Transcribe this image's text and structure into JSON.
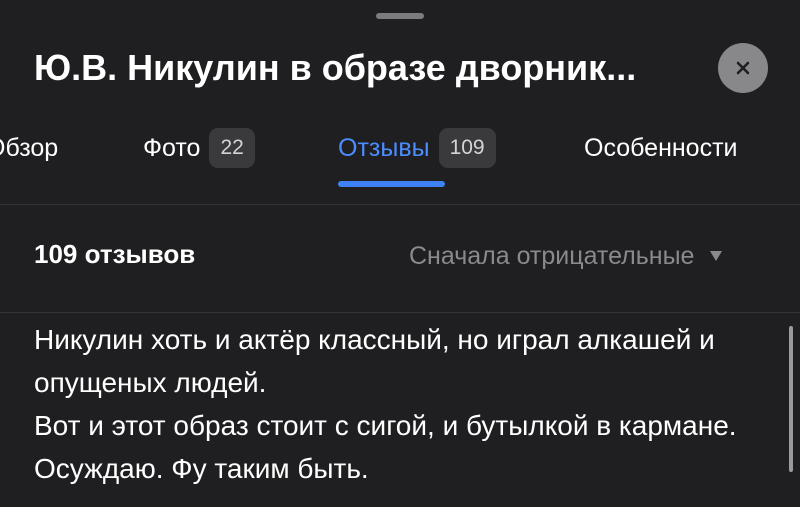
{
  "header": {
    "title": "Ю.В. Никулин в образе дворник...",
    "close_icon": "close-icon"
  },
  "tabs": [
    {
      "label": "Обзор",
      "count": null,
      "active": false
    },
    {
      "label": "Фото",
      "count": "22",
      "active": false
    },
    {
      "label": "Отзывы",
      "count": "109",
      "active": true
    },
    {
      "label": "Особенности",
      "count": null,
      "active": false
    }
  ],
  "reviews": {
    "count_label": "109 отзывов",
    "sort_label": "Сначала отрицательные",
    "sort_icon": "chevron-down-icon",
    "items": [
      {
        "text_lines": [
          "Никулин хоть и актёр классный, но играл алкашей и опущеных людей.",
          "Вот и этот образ стоит с сигой, и бутылкой в кармане. Осуждаю. Фу таким быть."
        ]
      }
    ]
  },
  "colors": {
    "background": "#1f1f21",
    "accent": "#3f82f7",
    "muted_text": "#8a8a8e",
    "badge_bg": "#3a3a3d"
  }
}
